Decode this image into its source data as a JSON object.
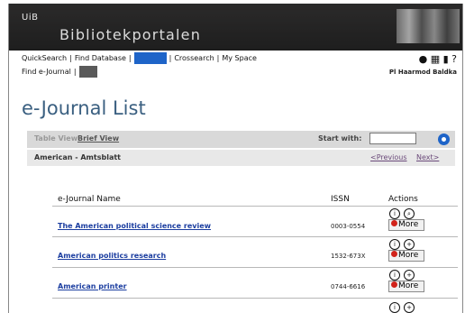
{
  "header": {
    "logo": "UiB",
    "title": "Bibliotekportalen",
    "user": "Pl Haarmod Baldka"
  },
  "nav": {
    "row1": [
      "QuickSearch",
      "Find Database",
      "",
      "Crossearch",
      "My Space"
    ],
    "row2": [
      "Find e-Journal",
      ""
    ]
  },
  "page": {
    "title": "e-Journal List"
  },
  "toolbar": {
    "table_view": "Table View",
    "brief_view": "Brief View",
    "start_with_label": "Start with:",
    "start_with_value": ""
  },
  "range": {
    "label": "American - Amtsblatt",
    "previous": "<Previous",
    "next": "Next>"
  },
  "table": {
    "columns": [
      "e-Journal Name",
      "ISSN",
      "Actions"
    ],
    "rows": [
      {
        "name": "The American political science review",
        "issn": "0003-0554"
      },
      {
        "name": "American politics research",
        "issn": "1532-673X"
      },
      {
        "name": "American printer",
        "issn": "0744-6616"
      }
    ],
    "more_label": "More"
  }
}
